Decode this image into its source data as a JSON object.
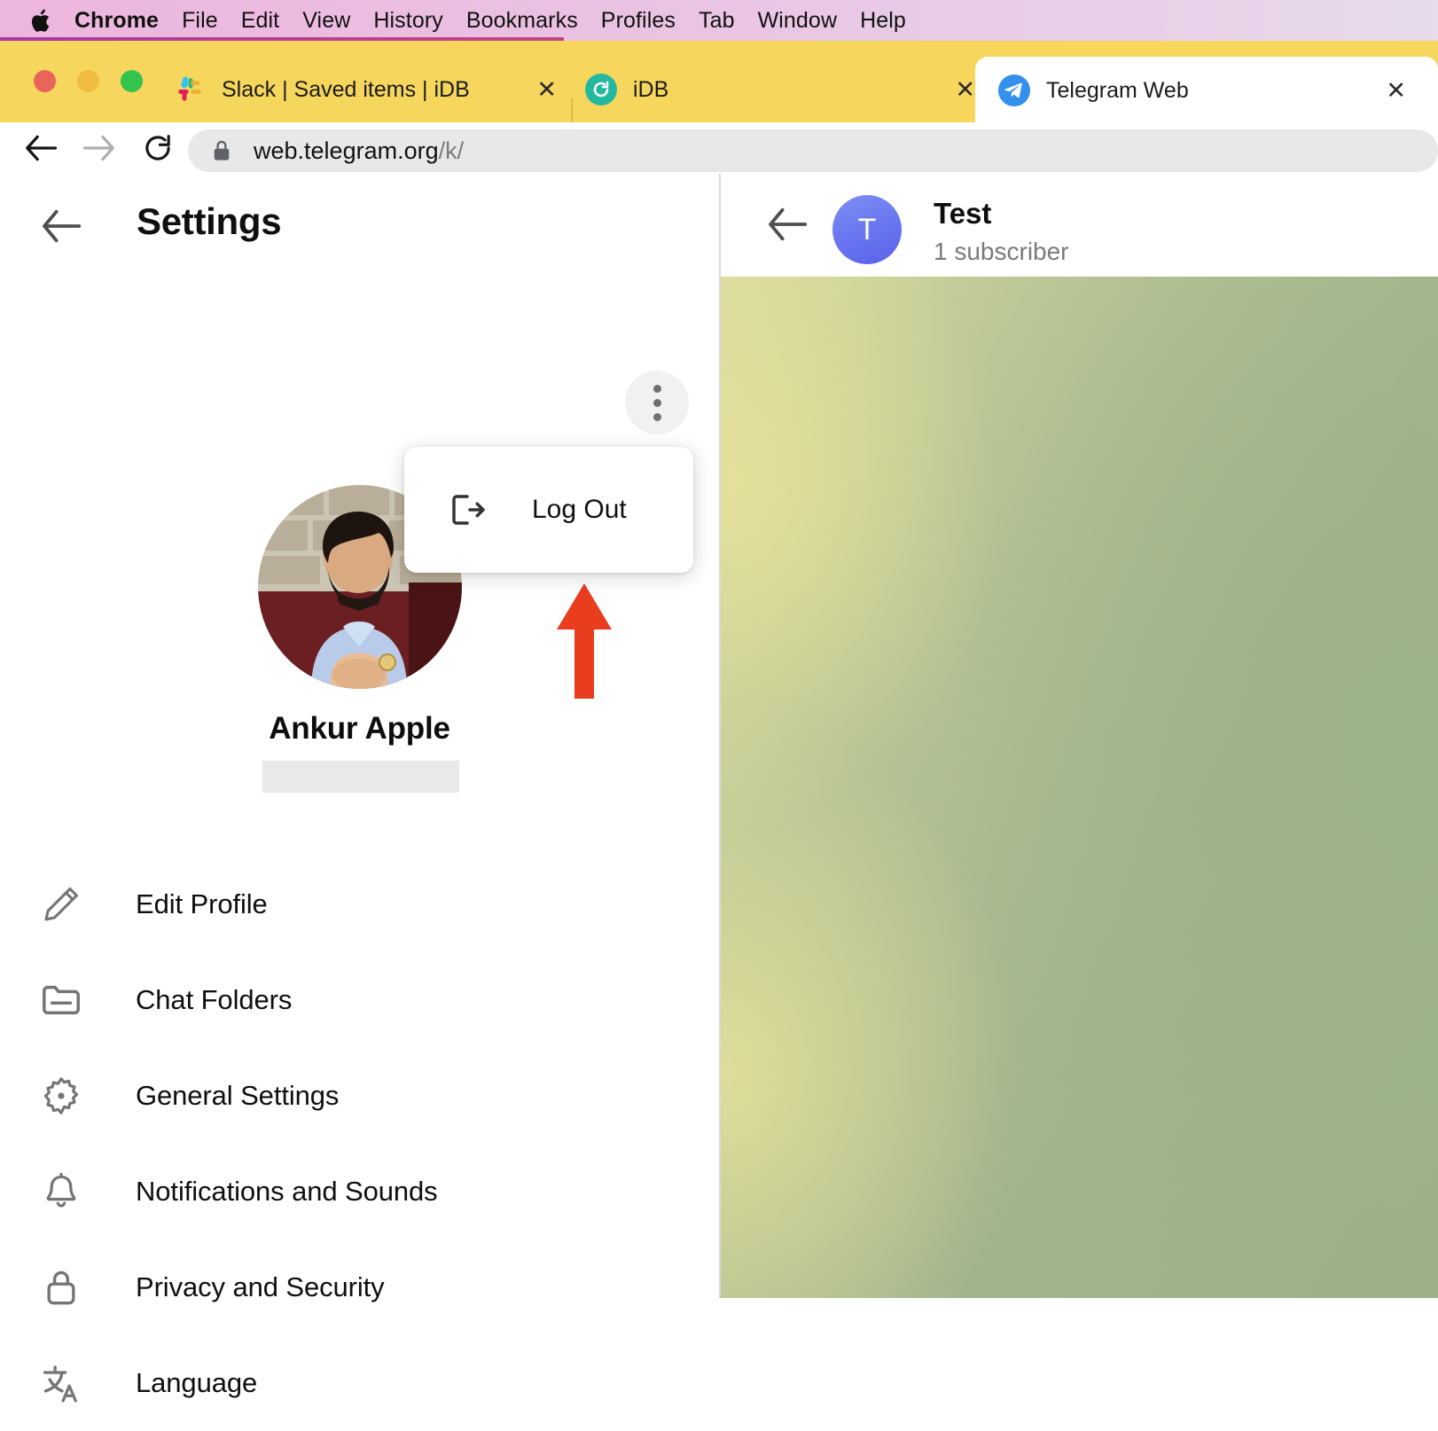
{
  "menubar": {
    "apple_icon": "apple-logo-icon",
    "items": [
      {
        "label": "Chrome",
        "bold": true
      },
      {
        "label": "File",
        "bold": false
      },
      {
        "label": "Edit",
        "bold": false
      },
      {
        "label": "View",
        "bold": false
      },
      {
        "label": "History",
        "bold": false
      },
      {
        "label": "Bookmarks",
        "bold": false
      },
      {
        "label": "Profiles",
        "bold": false
      },
      {
        "label": "Tab",
        "bold": false
      },
      {
        "label": "Window",
        "bold": false
      },
      {
        "label": "Help",
        "bold": false
      }
    ]
  },
  "browser": {
    "window_controls": [
      "close-button",
      "minimize-button",
      "maximize-button"
    ],
    "tabs": [
      {
        "title": "Slack | Saved items | iDB",
        "favicon": "slack-icon",
        "close": "✕",
        "active": false
      },
      {
        "title": "iDB",
        "favicon": "idb-icon",
        "close": "✕",
        "active": false
      },
      {
        "title": "Telegram Web",
        "favicon": "telegram-icon",
        "close": "✕",
        "active": true
      }
    ],
    "toolbar": {
      "back_icon": "back-arrow-icon",
      "forward_icon": "forward-arrow-icon",
      "reload_icon": "reload-icon",
      "lock_icon": "lock-icon",
      "url_host": "web.telegram.org",
      "url_path": "/k/"
    }
  },
  "settings": {
    "back_icon": "back-arrow-icon",
    "title": "Settings",
    "menu_icon": "kebab-menu-icon",
    "dropdown": {
      "icon": "logout-icon",
      "label": "Log Out"
    },
    "annotation": {
      "type": "up-arrow",
      "color": "#ea3c1f"
    },
    "profile": {
      "avatar": "user-avatar-photo",
      "name": "Ankur Apple",
      "phone_redacted": true
    },
    "items": [
      {
        "label": "Edit Profile",
        "icon": "pencil-icon"
      },
      {
        "label": "Chat Folders",
        "icon": "folder-icon"
      },
      {
        "label": "General Settings",
        "icon": "gear-icon"
      },
      {
        "label": "Notifications and Sounds",
        "icon": "bell-icon"
      },
      {
        "label": "Privacy and Security",
        "icon": "lock-icon"
      },
      {
        "label": "Language",
        "icon": "translate-icon"
      }
    ]
  },
  "chat": {
    "back_icon": "back-arrow-icon",
    "avatar_letter": "T",
    "name": "Test",
    "subtitle": "1 subscriber",
    "background_colors": [
      "#d9dba0",
      "#a3b58d",
      "#9bb086"
    ]
  },
  "colors": {
    "menubar_start": "#edb6dd",
    "menubar_end": "#e7dbec",
    "tabstrip": "#f7d65d",
    "accent_red": "#ea3c1f",
    "telegram_blue": "#3390ec"
  }
}
